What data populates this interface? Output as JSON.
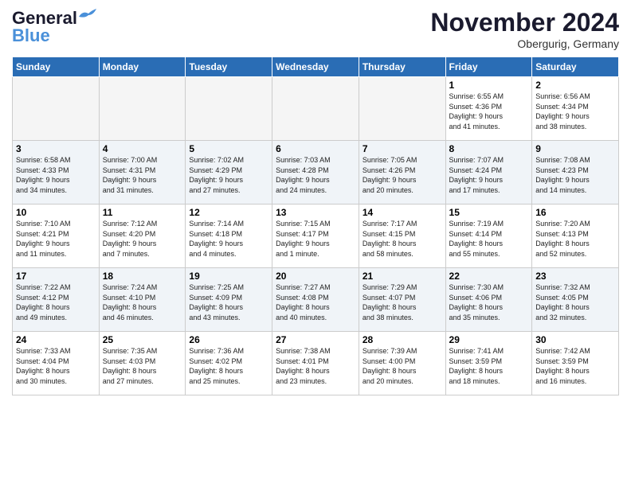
{
  "header": {
    "logo_line1": "General",
    "logo_line2": "Blue",
    "month_title": "November 2024",
    "location": "Obergurig, Germany"
  },
  "weekdays": [
    "Sunday",
    "Monday",
    "Tuesday",
    "Wednesday",
    "Thursday",
    "Friday",
    "Saturday"
  ],
  "weeks": [
    [
      {
        "day": "",
        "info": ""
      },
      {
        "day": "",
        "info": ""
      },
      {
        "day": "",
        "info": ""
      },
      {
        "day": "",
        "info": ""
      },
      {
        "day": "",
        "info": ""
      },
      {
        "day": "1",
        "info": "Sunrise: 6:55 AM\nSunset: 4:36 PM\nDaylight: 9 hours\nand 41 minutes."
      },
      {
        "day": "2",
        "info": "Sunrise: 6:56 AM\nSunset: 4:34 PM\nDaylight: 9 hours\nand 38 minutes."
      }
    ],
    [
      {
        "day": "3",
        "info": "Sunrise: 6:58 AM\nSunset: 4:33 PM\nDaylight: 9 hours\nand 34 minutes."
      },
      {
        "day": "4",
        "info": "Sunrise: 7:00 AM\nSunset: 4:31 PM\nDaylight: 9 hours\nand 31 minutes."
      },
      {
        "day": "5",
        "info": "Sunrise: 7:02 AM\nSunset: 4:29 PM\nDaylight: 9 hours\nand 27 minutes."
      },
      {
        "day": "6",
        "info": "Sunrise: 7:03 AM\nSunset: 4:28 PM\nDaylight: 9 hours\nand 24 minutes."
      },
      {
        "day": "7",
        "info": "Sunrise: 7:05 AM\nSunset: 4:26 PM\nDaylight: 9 hours\nand 20 minutes."
      },
      {
        "day": "8",
        "info": "Sunrise: 7:07 AM\nSunset: 4:24 PM\nDaylight: 9 hours\nand 17 minutes."
      },
      {
        "day": "9",
        "info": "Sunrise: 7:08 AM\nSunset: 4:23 PM\nDaylight: 9 hours\nand 14 minutes."
      }
    ],
    [
      {
        "day": "10",
        "info": "Sunrise: 7:10 AM\nSunset: 4:21 PM\nDaylight: 9 hours\nand 11 minutes."
      },
      {
        "day": "11",
        "info": "Sunrise: 7:12 AM\nSunset: 4:20 PM\nDaylight: 9 hours\nand 7 minutes."
      },
      {
        "day": "12",
        "info": "Sunrise: 7:14 AM\nSunset: 4:18 PM\nDaylight: 9 hours\nand 4 minutes."
      },
      {
        "day": "13",
        "info": "Sunrise: 7:15 AM\nSunset: 4:17 PM\nDaylight: 9 hours\nand 1 minute."
      },
      {
        "day": "14",
        "info": "Sunrise: 7:17 AM\nSunset: 4:15 PM\nDaylight: 8 hours\nand 58 minutes."
      },
      {
        "day": "15",
        "info": "Sunrise: 7:19 AM\nSunset: 4:14 PM\nDaylight: 8 hours\nand 55 minutes."
      },
      {
        "day": "16",
        "info": "Sunrise: 7:20 AM\nSunset: 4:13 PM\nDaylight: 8 hours\nand 52 minutes."
      }
    ],
    [
      {
        "day": "17",
        "info": "Sunrise: 7:22 AM\nSunset: 4:12 PM\nDaylight: 8 hours\nand 49 minutes."
      },
      {
        "day": "18",
        "info": "Sunrise: 7:24 AM\nSunset: 4:10 PM\nDaylight: 8 hours\nand 46 minutes."
      },
      {
        "day": "19",
        "info": "Sunrise: 7:25 AM\nSunset: 4:09 PM\nDaylight: 8 hours\nand 43 minutes."
      },
      {
        "day": "20",
        "info": "Sunrise: 7:27 AM\nSunset: 4:08 PM\nDaylight: 8 hours\nand 40 minutes."
      },
      {
        "day": "21",
        "info": "Sunrise: 7:29 AM\nSunset: 4:07 PM\nDaylight: 8 hours\nand 38 minutes."
      },
      {
        "day": "22",
        "info": "Sunrise: 7:30 AM\nSunset: 4:06 PM\nDaylight: 8 hours\nand 35 minutes."
      },
      {
        "day": "23",
        "info": "Sunrise: 7:32 AM\nSunset: 4:05 PM\nDaylight: 8 hours\nand 32 minutes."
      }
    ],
    [
      {
        "day": "24",
        "info": "Sunrise: 7:33 AM\nSunset: 4:04 PM\nDaylight: 8 hours\nand 30 minutes."
      },
      {
        "day": "25",
        "info": "Sunrise: 7:35 AM\nSunset: 4:03 PM\nDaylight: 8 hours\nand 27 minutes."
      },
      {
        "day": "26",
        "info": "Sunrise: 7:36 AM\nSunset: 4:02 PM\nDaylight: 8 hours\nand 25 minutes."
      },
      {
        "day": "27",
        "info": "Sunrise: 7:38 AM\nSunset: 4:01 PM\nDaylight: 8 hours\nand 23 minutes."
      },
      {
        "day": "28",
        "info": "Sunrise: 7:39 AM\nSunset: 4:00 PM\nDaylight: 8 hours\nand 20 minutes."
      },
      {
        "day": "29",
        "info": "Sunrise: 7:41 AM\nSunset: 3:59 PM\nDaylight: 8 hours\nand 18 minutes."
      },
      {
        "day": "30",
        "info": "Sunrise: 7:42 AM\nSunset: 3:59 PM\nDaylight: 8 hours\nand 16 minutes."
      }
    ]
  ]
}
